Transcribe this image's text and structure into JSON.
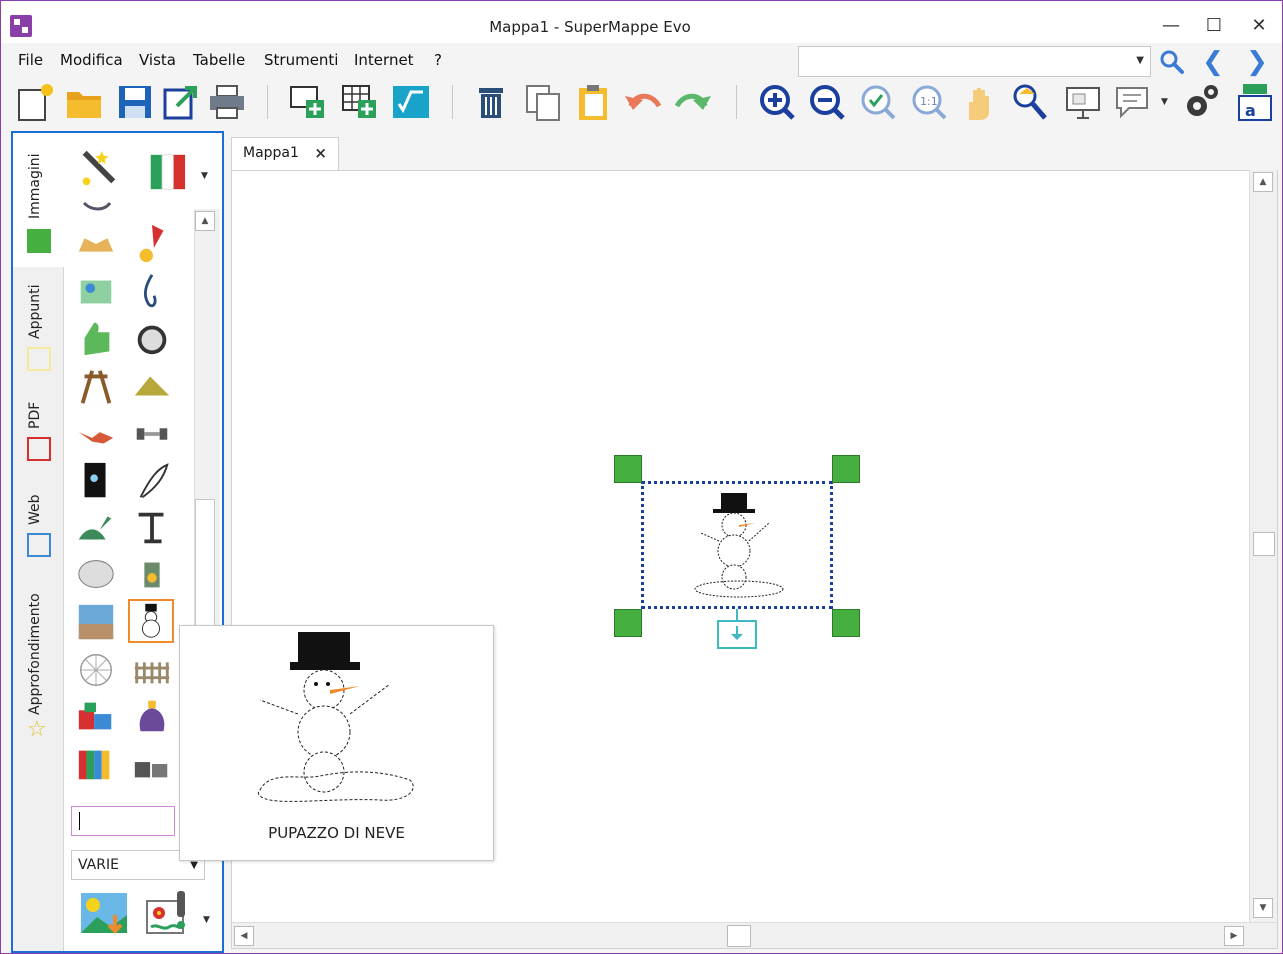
{
  "window": {
    "title": "Mappa1 - SuperMappe Evo"
  },
  "menu": [
    "File",
    "Modifica",
    "Vista",
    "Tabelle",
    "Strumenti",
    "Internet",
    "?"
  ],
  "search": {
    "value": ""
  },
  "toolbar": {
    "icons": [
      "new-map-icon",
      "open-folder-icon",
      "save-icon",
      "export-icon",
      "print-icon",
      "new-node-icon",
      "new-table-icon",
      "formula-icon",
      "delete-icon",
      "copy-icon",
      "paste-icon",
      "undo-icon",
      "redo-icon",
      "zoom-in-icon",
      "zoom-out-icon",
      "zoom-fit-icon",
      "zoom-actual-icon",
      "pan-hand-icon",
      "reader-icon",
      "presentation-icon",
      "comment-icon",
      "settings-icon",
      "text-format-icon"
    ]
  },
  "sidebar": {
    "tabs": [
      {
        "label": "Immagini",
        "color": "#45b03f"
      },
      {
        "label": "Appunti",
        "color": "#f3ea9e"
      },
      {
        "label": "PDF",
        "color": "#d63030"
      },
      {
        "label": "Web",
        "color": "#3a8ad6"
      },
      {
        "label": "Approfondimento",
        "color": "#e0c52a"
      }
    ],
    "category": "VARIE",
    "search_value": ""
  },
  "document": {
    "tab_label": "Mappa1",
    "close_label": "×"
  },
  "preview": {
    "caption": "PUPAZZO DI NEVE"
  },
  "colors": {
    "accent": "#1a6fd6",
    "handle": "#45b03f",
    "brand": "#8a3fa8"
  }
}
